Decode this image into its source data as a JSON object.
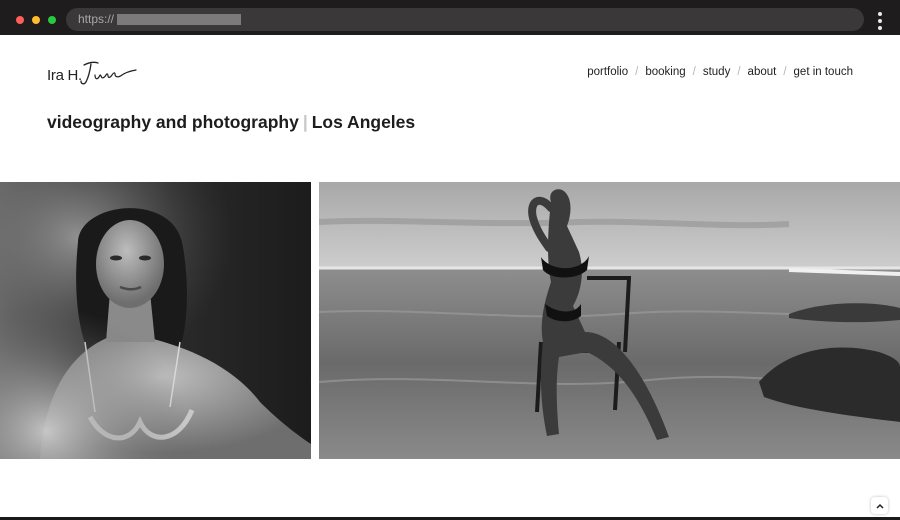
{
  "browser": {
    "url_scheme": "https://",
    "menu_icon": "kebab-menu-icon"
  },
  "site": {
    "logo_text": "Ira H.",
    "logo_signature": "June",
    "nav": [
      "portfolio",
      "booking",
      "study",
      "about",
      "get in touch"
    ],
    "nav_separator": "/",
    "tagline_main": "videography and photography",
    "tagline_sep": "|",
    "tagline_location": "Los Angeles"
  },
  "photos": [
    {
      "name": "portrait-photo",
      "style": "black-and-white"
    },
    {
      "name": "beach-chair-photo",
      "style": "black-and-white"
    }
  ],
  "scroll_top_icon": "chevron-up-icon",
  "colors": {
    "chrome_bg": "#1e1c1d",
    "urlbar_bg": "#3a3839",
    "dot_red": "#ff5f57",
    "dot_yellow": "#febc2e",
    "dot_green": "#28c840",
    "text": "#1a1a1a",
    "separator": "#b5b5b5"
  }
}
